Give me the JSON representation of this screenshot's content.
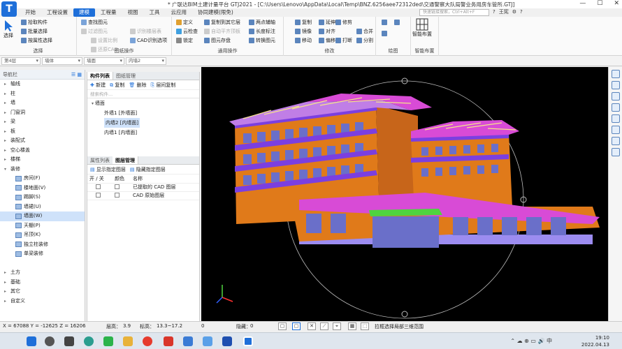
{
  "app": {
    "logo": "T",
    "title": "* 广联达BIM土建计量平台 GTJ2021 - [C:\\Users\\Lenovo\\AppData\\Local\\Temp\\BNZ.6256aee72312ded\\交通警察大队局警业务用房车管所.GTJ]",
    "quick_icons": [
      "?",
      "王宪",
      "⚙",
      "?"
    ],
    "window_controls": [
      "—",
      "☐",
      "✕"
    ]
  },
  "menu": [
    "开始",
    "工程设置",
    "建模",
    "工程量",
    "视图",
    "工具",
    "云应用",
    "协同建模(限免)"
  ],
  "menu_active": "建模",
  "search_placeholder": "快速链接搜索，Ctrl+Alt+F",
  "ribbon": {
    "select": {
      "big": "选择",
      "items": [
        "拾取构件",
        "批量选择",
        "按属性选择"
      ],
      "label": "选择"
    },
    "drawing": {
      "items": [
        "查找图元",
        "过滤图元",
        "设置比例",
        "还原CAD",
        "识别楼层表",
        "CAD识别选项"
      ],
      "label": "图纸操作"
    },
    "common": {
      "items": [
        "定义",
        "云检查",
        "锁定",
        "复制到其它层",
        "自动平齐顶板",
        "图元存盘",
        "两点辅轴",
        "长度标注",
        "转换图元"
      ],
      "label": "通用操作"
    },
    "modify": {
      "items": [
        "复制",
        "镜像",
        "移动",
        "延伸",
        "修剪",
        "打断",
        "合并",
        "分割",
        "对齐",
        "偏移"
      ],
      "label": "修改"
    },
    "draw": {
      "label": "绘图"
    },
    "smart": {
      "big": "智能布置",
      "label": "智能布置"
    }
  },
  "subbar": {
    "floor": "第4层",
    "category": "墙体",
    "type": "墙面",
    "component": "内墙2"
  },
  "nav": {
    "title": "导航栏",
    "items": [
      {
        "label": "轴线",
        "child": false
      },
      {
        "label": "柱",
        "child": false
      },
      {
        "label": "墙",
        "child": false
      },
      {
        "label": "门窗洞",
        "child": false
      },
      {
        "label": "梁",
        "child": false
      },
      {
        "label": "板",
        "child": false
      },
      {
        "label": "装配式",
        "child": false
      },
      {
        "label": "空心楼盖",
        "child": false
      },
      {
        "label": "楼梯",
        "child": false
      },
      {
        "label": "装修",
        "child": false
      },
      {
        "label": "房间(F)",
        "child": true
      },
      {
        "label": "楼地面(V)",
        "child": true
      },
      {
        "label": "踢脚(S)",
        "child": true
      },
      {
        "label": "墙裙(U)",
        "child": true
      },
      {
        "label": "墙面(W)",
        "child": true,
        "selected": true
      },
      {
        "label": "天棚(P)",
        "child": true
      },
      {
        "label": "吊顶(K)",
        "child": true
      },
      {
        "label": "独立柱装修",
        "child": true
      },
      {
        "label": "单梁装修",
        "child": true
      },
      {
        "label": "",
        "child": false
      },
      {
        "label": "土方",
        "child": false
      },
      {
        "label": "基础",
        "child": false
      },
      {
        "label": "其它",
        "child": false
      },
      {
        "label": "自定义",
        "child": false
      }
    ]
  },
  "components": {
    "tabs": [
      "构件列表",
      "图纸管理"
    ],
    "toolbar": [
      "新建",
      "复制",
      "删除",
      "层间复制"
    ],
    "search_placeholder": "搜索构件...",
    "group": "墙面",
    "items": [
      "外墙1 [外墙面]",
      "内墙2 [内墙面]",
      "内墙1 [内墙面]"
    ],
    "selected_index": 1
  },
  "layers": {
    "tabs": [
      "属性列表",
      "图层管理"
    ],
    "toolbar": [
      "显示指定图层",
      "隐藏指定图层"
    ],
    "headers": [
      "开 / 关",
      "颜色",
      "名称"
    ],
    "rows": [
      "已提取的 CAD 图层",
      "CAD 原始图层"
    ]
  },
  "status": {
    "coords": "X = 67088 Y = -12625 Z = 16206",
    "floor_height_label": "层高：",
    "floor_height": "3.9",
    "elevation_label": "标高：",
    "elevation": "13.3~17.2",
    "value1": "0",
    "hidden_label": "隐藏：",
    "hidden": "0",
    "hint": "拉框选择局部三维范围",
    "buttons": [
      "▢",
      "▢",
      "✕",
      "⟋",
      "⌖",
      "▦",
      "⬚"
    ]
  },
  "clock": {
    "time": "19:10",
    "date": "2022.04.13"
  },
  "colors": {
    "accent": "#1e6fd9",
    "wall": "#e07a1a",
    "roof": "#d84bd6",
    "slab": "#7b3fe0"
  }
}
